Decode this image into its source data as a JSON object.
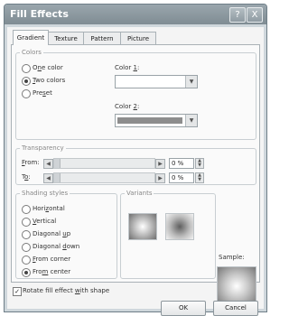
{
  "window": {
    "title": "Fill Effects"
  },
  "tabs": [
    "Gradient",
    "Texture",
    "Pattern",
    "Picture"
  ],
  "colors": {
    "legend": "Colors",
    "options": [
      {
        "pre": "O",
        "key": "n",
        "post": "e color",
        "selected": false
      },
      {
        "pre": "",
        "key": "T",
        "post": "wo colors",
        "selected": true
      },
      {
        "pre": "Pre",
        "key": "s",
        "post": "et",
        "selected": false
      }
    ],
    "color1_pre": "Color ",
    "color1_key": "1",
    "color1_post": ":",
    "color2_pre": "Color ",
    "color2_key": "2",
    "color2_post": ":",
    "color2_swatch": "#8d8d8d"
  },
  "transparency": {
    "legend": "Transparency",
    "from_key": "F",
    "from_post": "rom:",
    "to_pre": "T",
    "to_key": "o",
    "to_post": ":",
    "from_value": "0 %",
    "to_value": "0 %"
  },
  "shading": {
    "legend": "Shading styles",
    "options": [
      {
        "pre": "Hori",
        "key": "z",
        "post": "ontal",
        "selected": false
      },
      {
        "pre": "",
        "key": "V",
        "post": "ertical",
        "selected": false
      },
      {
        "pre": "Diagonal ",
        "key": "u",
        "post": "p",
        "selected": false
      },
      {
        "pre": "Diagonal ",
        "key": "d",
        "post": "own",
        "selected": false
      },
      {
        "pre": "",
        "key": "F",
        "post": "rom corner",
        "selected": false
      },
      {
        "pre": "Fro",
        "key": "m",
        "post": " center",
        "selected": true
      }
    ]
  },
  "variants": {
    "legend": "Variants"
  },
  "sample": {
    "label": "Sample:"
  },
  "rotate": {
    "pre": "Rotate fill effect ",
    "key": "w",
    "post": "ith shape",
    "checked": true,
    "mark": "✓"
  },
  "buttons": {
    "ok": "OK",
    "cancel": "Cancel"
  },
  "titlebar": {
    "help": "?",
    "close": "X"
  }
}
